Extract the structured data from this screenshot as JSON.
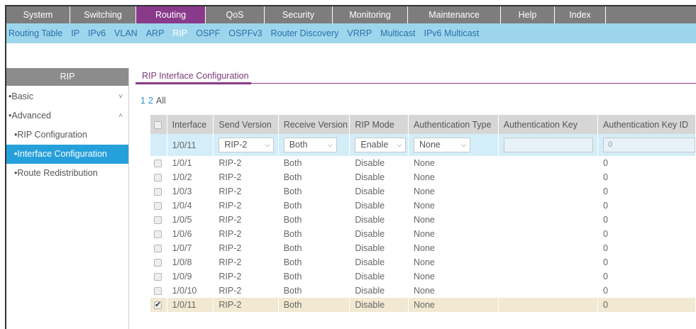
{
  "topnav": {
    "tabs": [
      {
        "label": "System",
        "active": false
      },
      {
        "label": "Switching",
        "active": false
      },
      {
        "label": "Routing",
        "active": true
      },
      {
        "label": "QoS",
        "active": false
      },
      {
        "label": "Security",
        "active": false
      },
      {
        "label": "Monitoring",
        "active": false
      },
      {
        "label": "Maintenance",
        "active": false
      },
      {
        "label": "Help",
        "active": false
      },
      {
        "label": "Index",
        "active": false
      }
    ]
  },
  "subnav": {
    "items": [
      {
        "label": "Routing Table",
        "active": false
      },
      {
        "label": "IP",
        "active": false
      },
      {
        "label": "IPv6",
        "active": false
      },
      {
        "label": "VLAN",
        "active": false
      },
      {
        "label": "ARP",
        "active": false
      },
      {
        "label": "RIP",
        "active": true
      },
      {
        "label": "OSPF",
        "active": false
      },
      {
        "label": "OSPFv3",
        "active": false
      },
      {
        "label": "Router Discovery",
        "active": false
      },
      {
        "label": "VRRP",
        "active": false
      },
      {
        "label": "Multicast",
        "active": false
      },
      {
        "label": "IPv6 Multicast",
        "active": false
      }
    ]
  },
  "sidebar": {
    "title": "RIP",
    "items": [
      {
        "label": "Basic",
        "bullet": "•",
        "chevron": "˅",
        "level": 0,
        "active": false
      },
      {
        "label": "Advanced",
        "bullet": "•",
        "chevron": "˄",
        "level": 0,
        "active": false
      },
      {
        "label": "RIP Configuration",
        "bullet": "•",
        "chevron": "",
        "level": 1,
        "active": false
      },
      {
        "label": "Interface Configuration",
        "bullet": "•",
        "chevron": "",
        "level": 1,
        "active": true
      },
      {
        "label": "Route Redistribution",
        "bullet": "•",
        "chevron": "",
        "level": 1,
        "active": false
      }
    ]
  },
  "content": {
    "tab_label": "RIP Interface Configuration",
    "pager": [
      "1",
      "2",
      "All"
    ]
  },
  "table": {
    "headers": [
      "Interface",
      "Send Version",
      "Receive Version",
      "RIP Mode",
      "Authentication Type",
      "Authentication Key",
      "Authentication Key ID"
    ],
    "edit_row": {
      "interface": "1/0/11",
      "send_version": "RIP-2",
      "receive_version": "Both",
      "rip_mode": "Enable",
      "auth_type": "None",
      "auth_key": "",
      "auth_key_id_placeholder": "0"
    },
    "rows": [
      {
        "checked": false,
        "interface": "1/0/1",
        "send": "RIP-2",
        "receive": "Both",
        "mode": "Disable",
        "auth": "None",
        "key": "",
        "key_id": "0"
      },
      {
        "checked": false,
        "interface": "1/0/2",
        "send": "RIP-2",
        "receive": "Both",
        "mode": "Disable",
        "auth": "None",
        "key": "",
        "key_id": "0"
      },
      {
        "checked": false,
        "interface": "1/0/3",
        "send": "RIP-2",
        "receive": "Both",
        "mode": "Disable",
        "auth": "None",
        "key": "",
        "key_id": "0"
      },
      {
        "checked": false,
        "interface": "1/0/4",
        "send": "RIP-2",
        "receive": "Both",
        "mode": "Disable",
        "auth": "None",
        "key": "",
        "key_id": "0"
      },
      {
        "checked": false,
        "interface": "1/0/5",
        "send": "RIP-2",
        "receive": "Both",
        "mode": "Disable",
        "auth": "None",
        "key": "",
        "key_id": "0"
      },
      {
        "checked": false,
        "interface": "1/0/6",
        "send": "RIP-2",
        "receive": "Both",
        "mode": "Disable",
        "auth": "None",
        "key": "",
        "key_id": "0"
      },
      {
        "checked": false,
        "interface": "1/0/7",
        "send": "RIP-2",
        "receive": "Both",
        "mode": "Disable",
        "auth": "None",
        "key": "",
        "key_id": "0"
      },
      {
        "checked": false,
        "interface": "1/0/8",
        "send": "RIP-2",
        "receive": "Both",
        "mode": "Disable",
        "auth": "None",
        "key": "",
        "key_id": "0"
      },
      {
        "checked": false,
        "interface": "1/0/9",
        "send": "RIP-2",
        "receive": "Both",
        "mode": "Disable",
        "auth": "None",
        "key": "",
        "key_id": "0"
      },
      {
        "checked": false,
        "interface": "1/0/10",
        "send": "RIP-2",
        "receive": "Both",
        "mode": "Disable",
        "auth": "None",
        "key": "",
        "key_id": "0"
      },
      {
        "checked": true,
        "interface": "1/0/11",
        "send": "RIP-2",
        "receive": "Both",
        "mode": "Disable",
        "auth": "None",
        "key": "",
        "key_id": "0"
      }
    ]
  },
  "colors": {
    "topnav_bg": "#7d7d7d",
    "topnav_active": "#8a3a8a",
    "subnav_bg": "#9dd6ec",
    "sidebar_active": "#26a0da",
    "selected_row": "#f1e9d2",
    "edit_row": "#d4eef9"
  }
}
